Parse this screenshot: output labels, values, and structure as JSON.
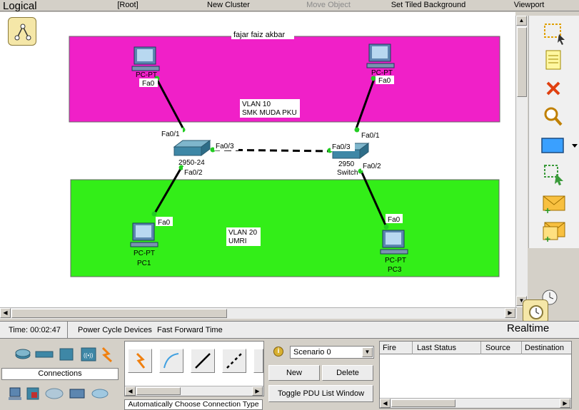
{
  "top_menu": {
    "logical": "Logical",
    "root": "[Root]",
    "new_cluster": "New Cluster",
    "move_object": "Move Object",
    "set_tiled_background": "Set Tiled Background",
    "viewport": "Viewport"
  },
  "workspace": {
    "title_note": "fajar faiz akbar",
    "vlan10_label_1": "VLAN 10",
    "vlan10_label_2": "SMK MUDA PKU",
    "vlan20_label_1": "VLAN 20",
    "vlan20_label_2": "UMRI",
    "pc_left_top": {
      "label": "PC-PT",
      "port": "Fa0"
    },
    "pc_right_top": {
      "label": "PC-PT",
      "port": "Fa0"
    },
    "pc1": {
      "label1": "PC-PT",
      "label2": "PC1",
      "port": "Fa0"
    },
    "pc3": {
      "label1": "PC-PT",
      "label2": "PC3",
      "port": "Fa0"
    },
    "switch_left": {
      "label": "2950-24",
      "port_up": "Fa0/1",
      "port_right": "Fa0/3",
      "port_down": "Fa0/2"
    },
    "switch_right": {
      "label1": "2950",
      "label2": "Switch",
      "port_up": "Fa0/1",
      "port_left": "Fa0/3",
      "port_down": "Fa0/2"
    },
    "colors": {
      "vlan10": "#f020c8",
      "vlan20": "#33ee18",
      "link": "#000000",
      "port_dot": "#22cc22"
    }
  },
  "status": {
    "time": "Time: 00:02:47",
    "power_cycle": "Power Cycle Devices",
    "fast_forward": "Fast Forward Time",
    "realtime": "Realtime"
  },
  "device_panel": {
    "category_label": "Connections",
    "auto_connection": "Automatically Choose Connection Type"
  },
  "scenario": {
    "selected": "Scenario 0",
    "new_label": "New",
    "delete_label": "Delete",
    "toggle_label": "Toggle PDU List Window"
  },
  "pdu_table": {
    "columns": [
      "Fire",
      "Last Status",
      "Source",
      "Destination"
    ]
  }
}
